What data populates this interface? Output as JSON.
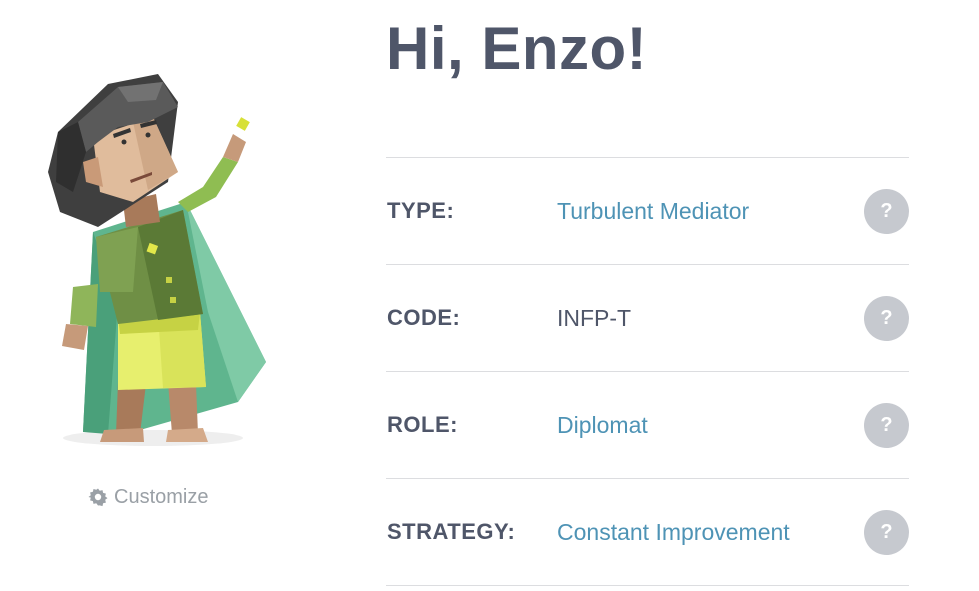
{
  "greeting": "Hi, Enzo!",
  "customize": {
    "label": "Customize",
    "icon": "gear-icon"
  },
  "rows": [
    {
      "label": "TYPE:",
      "value": "Turbulent Mediator",
      "link": true,
      "help": "?"
    },
    {
      "label": "CODE:",
      "value": "INFP-T",
      "link": false,
      "help": "?"
    },
    {
      "label": "ROLE:",
      "value": "Diplomat",
      "link": true,
      "help": "?"
    },
    {
      "label": "STRATEGY:",
      "value": "Constant Improvement",
      "link": true,
      "help": "?"
    }
  ],
  "colors": {
    "heading": "#4f5669",
    "link": "#4e93b5",
    "help_bg": "#c6c9cf",
    "divider": "#dcdde0"
  }
}
